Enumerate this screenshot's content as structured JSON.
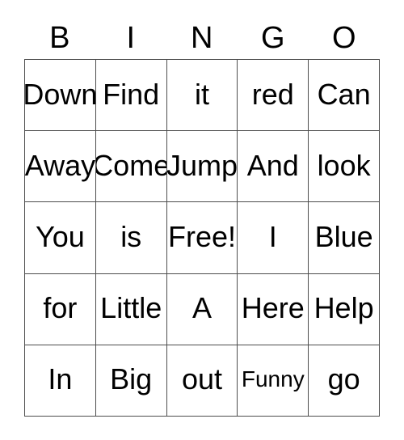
{
  "card": {
    "header_letters": [
      "B",
      "I",
      "N",
      "G",
      "O"
    ],
    "rows": [
      [
        {
          "text": "Down",
          "size": "normal"
        },
        {
          "text": "Find",
          "size": "normal"
        },
        {
          "text": "it",
          "size": "normal"
        },
        {
          "text": "red",
          "size": "normal"
        },
        {
          "text": "Can",
          "size": "normal"
        }
      ],
      [
        {
          "text": "Away",
          "size": "normal"
        },
        {
          "text": "Come",
          "size": "normal"
        },
        {
          "text": "Jump",
          "size": "normal"
        },
        {
          "text": "And",
          "size": "normal"
        },
        {
          "text": "look",
          "size": "normal"
        }
      ],
      [
        {
          "text": "You",
          "size": "normal"
        },
        {
          "text": "is",
          "size": "normal"
        },
        {
          "text": "Free!",
          "size": "normal"
        },
        {
          "text": "I",
          "size": "normal"
        },
        {
          "text": "Blue",
          "size": "normal"
        }
      ],
      [
        {
          "text": "for",
          "size": "normal"
        },
        {
          "text": "Little",
          "size": "normal"
        },
        {
          "text": "A",
          "size": "normal"
        },
        {
          "text": "Here",
          "size": "normal"
        },
        {
          "text": "Help",
          "size": "normal"
        }
      ],
      [
        {
          "text": "In",
          "size": "normal"
        },
        {
          "text": "Big",
          "size": "normal"
        },
        {
          "text": "out",
          "size": "normal"
        },
        {
          "text": "Funny",
          "size": "small"
        },
        {
          "text": "go",
          "size": "normal"
        }
      ]
    ],
    "colors": {
      "text": "#000000",
      "border": "#4d4d4d",
      "background": "#ffffff"
    }
  }
}
